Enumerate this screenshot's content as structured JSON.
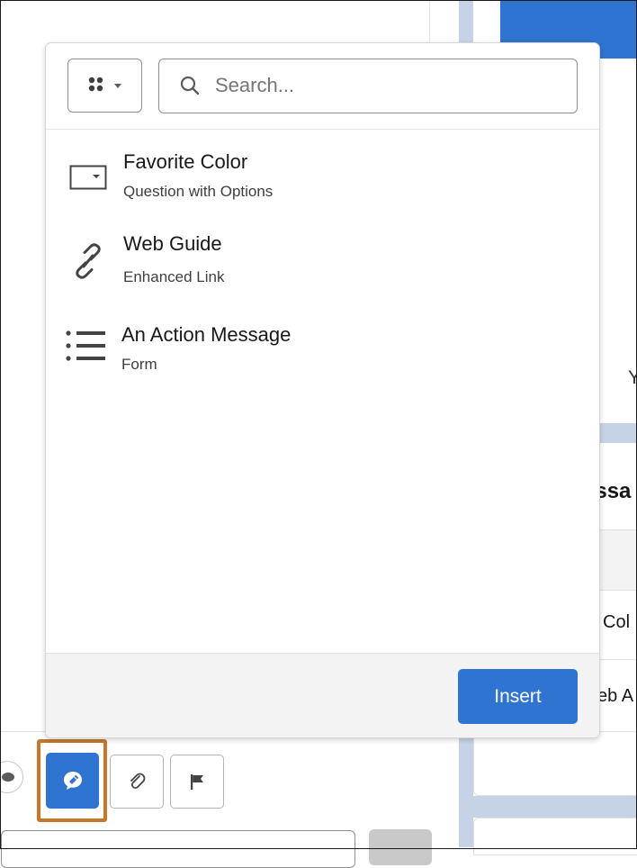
{
  "popover": {
    "search": {
      "placeholder": "Search...",
      "value": ""
    },
    "items": [
      {
        "title": "Favorite Color",
        "subtitle": "Question with Options",
        "icon": "dropdown-field-icon"
      },
      {
        "title": "Web Guide",
        "subtitle": "Enhanced Link",
        "icon": "link-icon"
      },
      {
        "title": "An Action Message",
        "subtitle": "Form",
        "icon": "list-icon"
      }
    ],
    "insert_label": "Insert"
  },
  "background": {
    "right_letter": "Y",
    "right_heading": "essa",
    "right_row1": "Col",
    "right_row2": "eb A"
  },
  "toolbar": {
    "active_button_icon": "quick-text-icon",
    "attach_icon": "paperclip-icon",
    "flag_icon": "flag-icon"
  },
  "colors": {
    "brand_blue": "#2f74d0",
    "highlight_orange": "#c7772a",
    "side_blue": "#c6d3e6"
  }
}
